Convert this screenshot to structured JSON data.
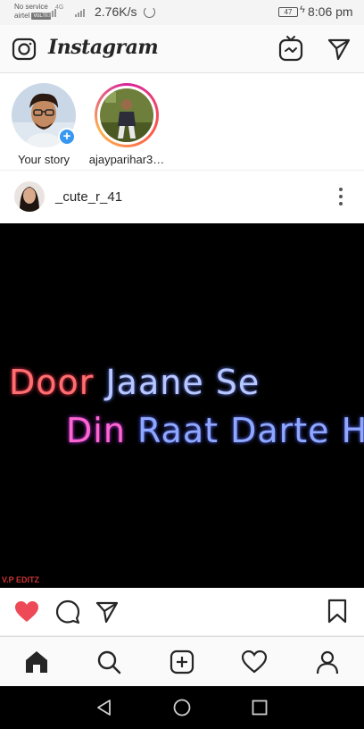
{
  "status_bar": {
    "carrier_top": "No service",
    "carrier_bottom": "airtel",
    "carrier_tag": "VoLTE",
    "network_type": "4G",
    "data_speed": "2.76K/s",
    "battery": "47",
    "time": "8:06 pm"
  },
  "header": {
    "app_title": "Instagram",
    "left_icon": "camera-icon",
    "right_icons": [
      "igtv-icon",
      "direct-send-icon"
    ]
  },
  "stories": [
    {
      "label": "Your story",
      "has_add_badge": true,
      "add_symbol": "+"
    },
    {
      "label": "ajayparihar3…",
      "has_ring": true
    }
  ],
  "post": {
    "username": "_cute_r_41",
    "caption_lines": [
      {
        "a": "Door ",
        "b": "Jaane ",
        "c": "Se"
      },
      {
        "a": "Din ",
        "b": "Raat ",
        "c": "Darte ",
        "d": "He"
      }
    ],
    "watermark": "V.P EDITZ",
    "liked": true,
    "colors": {
      "like": "#ed4956",
      "lyric_red": "#ff6f6f",
      "lyric_pink": "#ff66cc"
    }
  },
  "bottom_nav": [
    "home-icon",
    "search-icon",
    "add-post-icon",
    "activity-heart-icon",
    "profile-icon"
  ],
  "android_nav": [
    "back-icon",
    "home-circle-icon",
    "recents-icon"
  ]
}
